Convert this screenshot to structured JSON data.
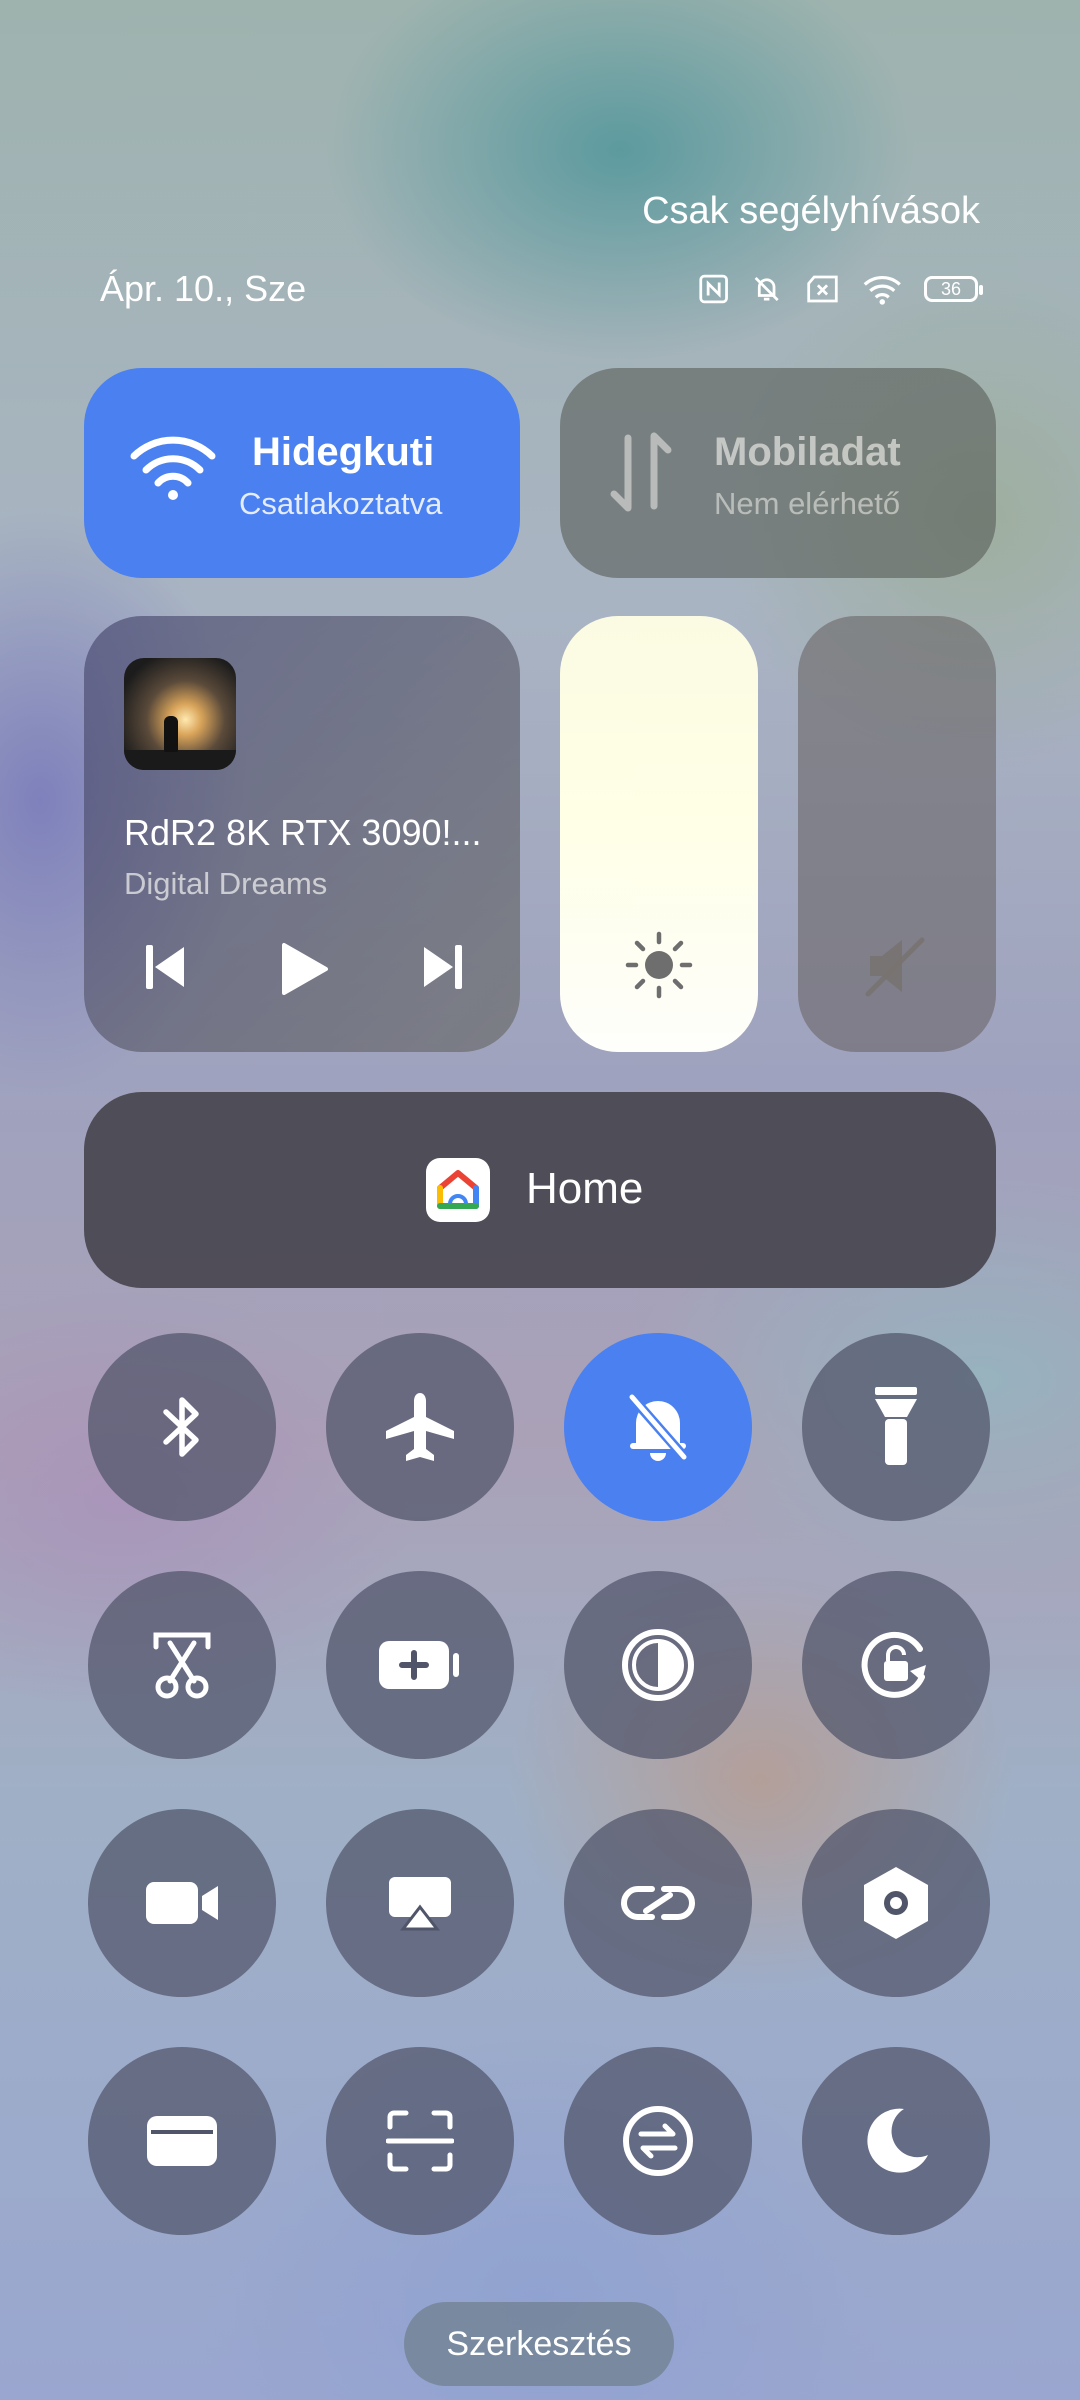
{
  "status_bar": {
    "emergency_text": "Csak segélyhívások",
    "date": "Ápr. 10., Sze",
    "battery_level": "36",
    "icons": [
      "nfc-icon",
      "bell-off-icon",
      "no-sim-icon",
      "wifi-icon",
      "battery-icon"
    ]
  },
  "wifi_tile": {
    "title": "Hidegkuti",
    "subtitle": "Csatlakoztatva",
    "active": true,
    "color": "#4a80f0"
  },
  "mobile_tile": {
    "title": "Mobiladat",
    "subtitle": "Nem elérhető",
    "active": false
  },
  "media": {
    "title": "RdR2 8K RTX 3090!...",
    "artist": "Digital Dreams",
    "controls": [
      "previous-icon",
      "play-icon",
      "next-icon"
    ]
  },
  "brightness": {
    "icon": "sun-icon"
  },
  "volume": {
    "icon": "speaker-muted-icon"
  },
  "home": {
    "label": "Home",
    "icon": "google-home-icon"
  },
  "toggles": [
    {
      "name": "bluetooth",
      "active": false
    },
    {
      "name": "airplane",
      "active": false
    },
    {
      "name": "silent",
      "active": true
    },
    {
      "name": "flashlight",
      "active": false
    },
    {
      "name": "screenshot",
      "active": false
    },
    {
      "name": "battery-saver",
      "active": false
    },
    {
      "name": "dark-mode",
      "active": false
    },
    {
      "name": "rotation-lock",
      "active": false
    },
    {
      "name": "screen-recorder",
      "active": false
    },
    {
      "name": "cast",
      "active": false
    },
    {
      "name": "link",
      "active": false
    },
    {
      "name": "settings",
      "active": false
    },
    {
      "name": "wallet",
      "active": false
    },
    {
      "name": "scanner",
      "active": false
    },
    {
      "name": "sync",
      "active": false
    },
    {
      "name": "do-not-disturb",
      "active": false
    }
  ],
  "edit_button": {
    "label": "Szerkesztés"
  }
}
